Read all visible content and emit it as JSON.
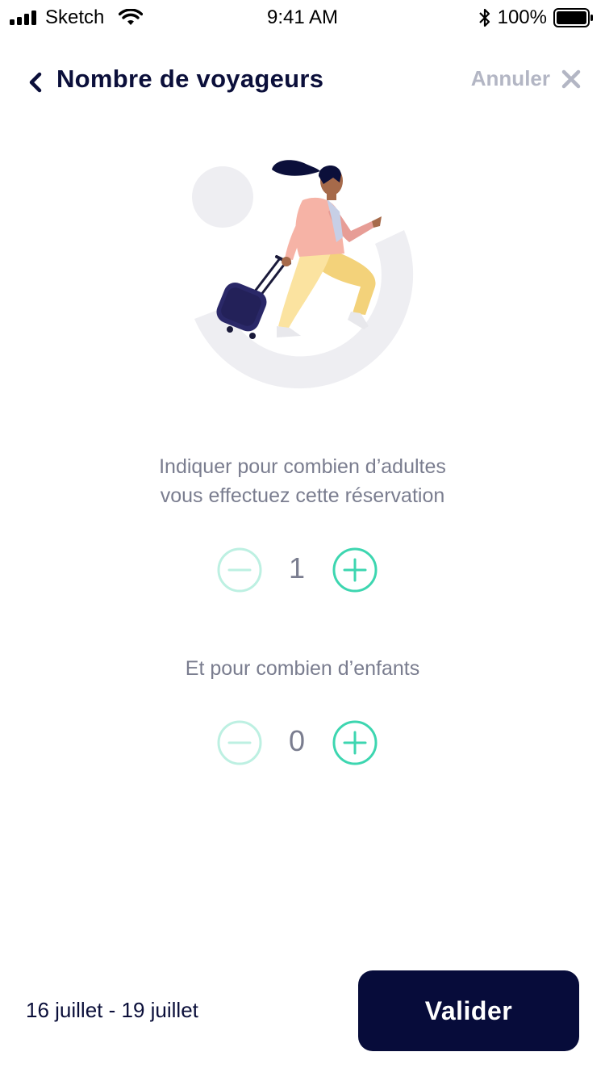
{
  "status_bar": {
    "carrier": "Sketch",
    "time": "9:41 AM",
    "battery": "100%"
  },
  "header": {
    "title": "Nombre de voyageurs",
    "cancel_label": "Annuler"
  },
  "questions": {
    "adults_line1": "Indiquer pour combien d’adultes",
    "adults_line2": "vous effectuez cette réservation",
    "children": "Et pour combien d’enfants"
  },
  "steppers": {
    "adults_count": "1",
    "children_count": "0"
  },
  "footer": {
    "date_range": "16 juillet - 19 juillet",
    "validate_label": "Valider"
  },
  "colors": {
    "primary": "#070c3a",
    "accent": "#3dd6b0",
    "accent_disabled": "#bdf0e2",
    "muted_text": "#7a7d8f",
    "cancel": "#b3b6c4"
  },
  "icons": {
    "back": "chevron-left-icon",
    "close": "close-icon",
    "minus": "minus-circle-icon",
    "plus": "plus-circle-icon"
  }
}
